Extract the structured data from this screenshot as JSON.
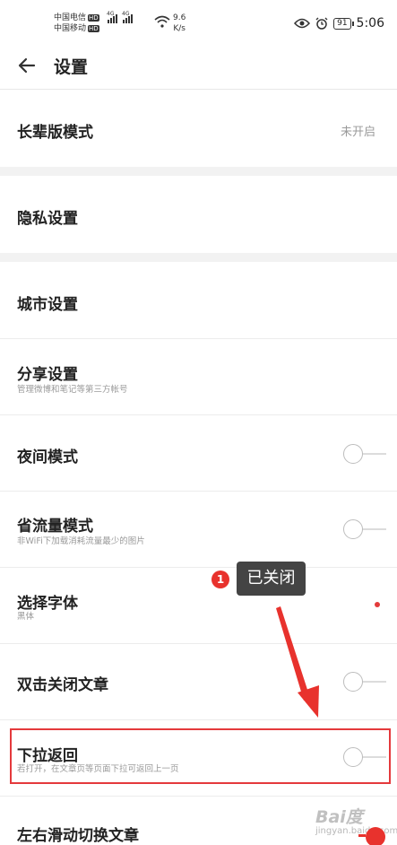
{
  "status_bar": {
    "carrier_1": "中国电信",
    "carrier_2": "中国移动",
    "hd_badge": "HD",
    "network_type": "4G",
    "speed_value": "9.6",
    "speed_unit": "K/s",
    "battery": "91",
    "time": "5:06"
  },
  "header": {
    "title": "设置"
  },
  "settings": {
    "elder_mode": {
      "label": "长辈版模式",
      "value": "未开启"
    },
    "privacy": {
      "label": "隐私设置"
    },
    "city": {
      "label": "城市设置"
    },
    "share": {
      "label": "分享设置",
      "subtitle": "管理微博和笔记等第三方帐号"
    },
    "night_mode": {
      "label": "夜间模式",
      "enabled": false
    },
    "data_saver": {
      "label": "省流量模式",
      "subtitle": "非WiFi下加载消耗流量最少的图片",
      "enabled": false
    },
    "font": {
      "label": "选择字体",
      "subtitle": "黑体"
    },
    "double_tap_close": {
      "label": "双击关闭文章",
      "enabled": false
    },
    "pull_back": {
      "label": "下拉返回",
      "subtitle": "若打开，在文章页等页面下拉可返回上一页",
      "enabled": false
    },
    "swipe_switch": {
      "label": "左右滑动切换文章"
    }
  },
  "annotation": {
    "badge_number": "1",
    "tooltip_text": "已关闭"
  },
  "watermark": {
    "brand": "Bai度",
    "url": "jingyan.baidu.com"
  },
  "colors": {
    "accent_red": "#e4393c",
    "tooltip_bg": "#444444",
    "section_gap": "#f2f2f2"
  }
}
